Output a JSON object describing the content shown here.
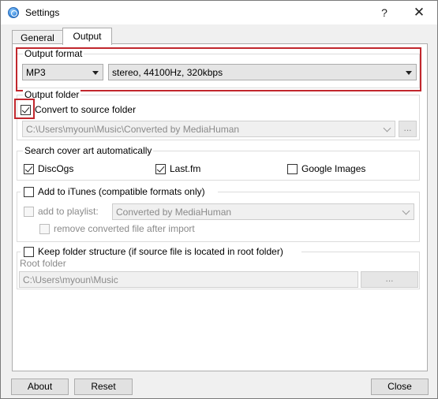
{
  "window": {
    "title": "Settings",
    "help_label": "?",
    "close_label": "✕"
  },
  "tabs": [
    {
      "label": "General"
    },
    {
      "label": "Output"
    }
  ],
  "output_format": {
    "legend": "Output format",
    "format_value": "MP3",
    "quality_value": "stereo, 44100Hz, 320kbps"
  },
  "output_folder": {
    "legend": "Output folder",
    "convert_to_source_label": "Convert to source folder",
    "convert_to_source_checked": true,
    "path_value": "C:\\Users\\myoun\\Music\\Converted by MediaHuman",
    "browse_label": "..."
  },
  "cover_art": {
    "legend": "Search cover art automatically",
    "options": [
      {
        "label": "DiscOgs",
        "checked": true
      },
      {
        "label": "Last.fm",
        "checked": true
      },
      {
        "label": "Google Images",
        "checked": false
      }
    ]
  },
  "itunes": {
    "label": "Add to iTunes (compatible formats only)",
    "checked": false,
    "playlist_label": "add to playlist:",
    "playlist_value": "Converted by MediaHuman",
    "remove_label": "remove converted file after import"
  },
  "folder_structure": {
    "label": "Keep folder structure (if source file is located in root folder)",
    "checked": false,
    "root_label": "Root folder",
    "root_value": "C:\\Users\\myoun\\Music",
    "browse_label": "..."
  },
  "buttons": {
    "about": "About",
    "reset": "Reset",
    "close": "Close"
  },
  "colors": {
    "highlight_box": "#c1272d"
  }
}
